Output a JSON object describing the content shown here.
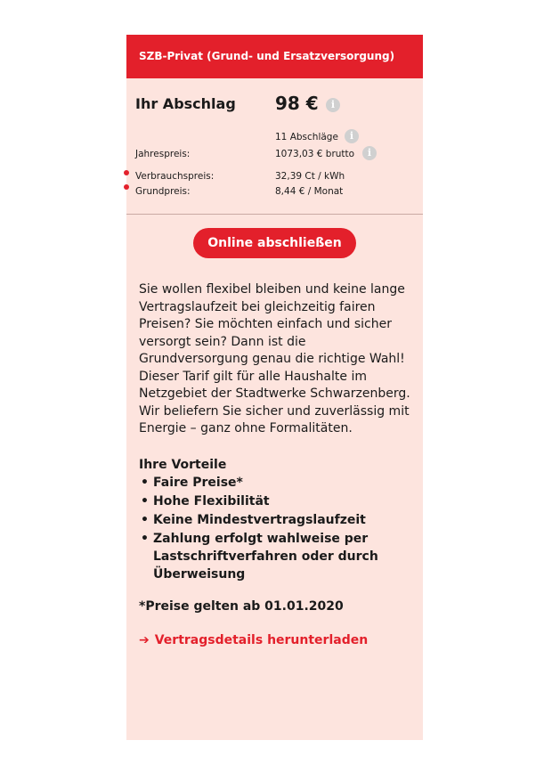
{
  "header": {
    "title": "SZB-Privat (Grund- und Ersatzversorgung)"
  },
  "price": {
    "abschlag_label": "Ihr Abschlag",
    "abschlag_value": "98 €",
    "abschlaege_count": "11 Abschläge",
    "jahrespreis_label": "Jahrespreis:",
    "jahrespreis_value": "1073,03 € brutto",
    "verbrauchspreis_label": "Verbrauchspreis:",
    "verbrauchspreis_value": "32,39 Ct / kWh",
    "grundpreis_label": "Grundpreis:",
    "grundpreis_value": "8,44 € / Monat",
    "info_icon": "i"
  },
  "cta": {
    "label": "Online abschließen"
  },
  "description": "Sie wollen flexibel bleiben und keine lange Vertragslaufzeit bei gleichzeitig fairen Preisen? Sie möchten einfach und sicher versorgt sein? Dann ist die Grundversorgung genau die richtige Wahl! Dieser Tarif gilt für alle Haushalte im Netzgebiet der Stadtwerke Schwarzenberg. Wir beliefern Sie sicher und zuverlässig mit Energie – ganz ohne Formalitäten.",
  "benefits": {
    "title": "Ihre Vorteile",
    "items": [
      "Faire Preise*",
      "Hohe Flexibilität",
      "Keine Mindestvertragslaufzeit",
      "Zahlung erfolgt wahlweise per Lastschriftverfahren oder durch Überweisung"
    ]
  },
  "note": "*Preise gelten ab 01.01.2020",
  "download": {
    "arrow": "➔",
    "label": "Vertragsdetails herunterladen"
  },
  "colors": {
    "accent": "#e3202b",
    "card_background": "#fde4de"
  }
}
